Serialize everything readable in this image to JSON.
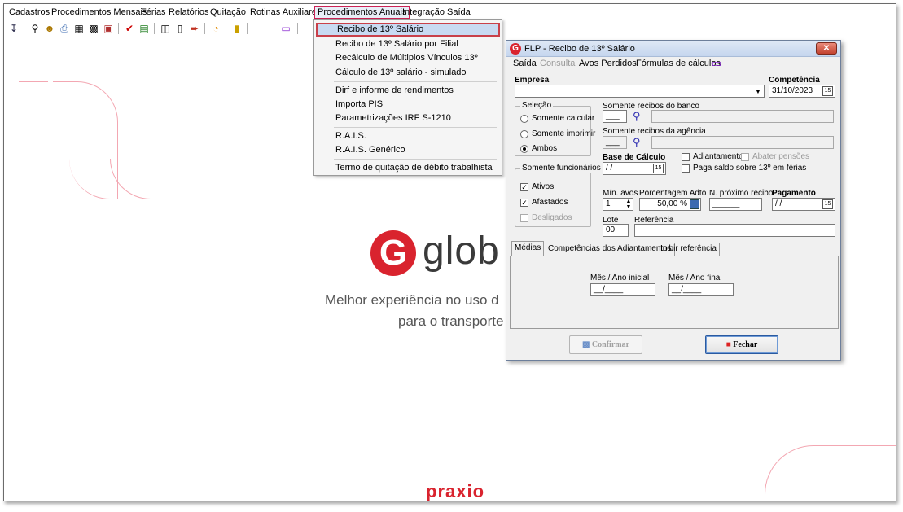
{
  "menubar": {
    "items": [
      "Cadastros",
      "Procedimentos Mensais",
      "Férias",
      "Relatórios",
      "Quitação",
      "Rotinas Auxiliares",
      "Procedimentos Anuais",
      "Integração",
      "Saída"
    ],
    "active": "Procedimentos Anuais"
  },
  "dropdown": {
    "items": [
      "Recibo de 13º Salário",
      "Recibo de 13º Salário por Filial",
      "Recálculo de Múltiplos Vínculos 13º",
      "Cálculo de 13º salário - simulado",
      "Dirf e informe de rendimentos",
      "Importa PIS",
      "Parametrizações IRF S-1210",
      "R.A.I.S.",
      "R.A.I.S. Genérico",
      "Termo de quitação de débito trabalhista"
    ],
    "selected": "Recibo de 13º Salário"
  },
  "background": {
    "logo_letter": "G",
    "logo_word": "glob",
    "tagline1": "Melhor experiência no uso d",
    "tagline2": "para o transporte",
    "brand": "praxio"
  },
  "dialog": {
    "title": "FLP - Recibo de 13º Salário",
    "menu": [
      "Saída",
      "Consulta",
      "Avos Perdidos",
      "Fórmulas de cálculos"
    ],
    "empresa_label": "Empresa",
    "empresa_value": "",
    "competencia_label": "Competência",
    "competencia_value": "31/10/2023",
    "selecao": {
      "title": "Seleção",
      "options": [
        "Somente calcular",
        "Somente imprimir",
        "Ambos"
      ],
      "selected": "Ambos"
    },
    "banco_label": "Somente recibos do banco",
    "agencia_label": "Somente recibos da agência",
    "base_calculo_label": "Base de Cálculo",
    "base_calculo_value": " / /",
    "adiantamento_label": "Adiantamento",
    "abater_pensoes_label": "Abater pensões",
    "paga_saldo_label": "Paga saldo sobre 13º em férias",
    "funcionarios": {
      "title": "Somente funcionários",
      "options": [
        {
          "label": "Ativos",
          "checked": true,
          "enabled": true
        },
        {
          "label": "Afastados",
          "checked": true,
          "enabled": true
        },
        {
          "label": "Desligados",
          "checked": false,
          "enabled": false
        }
      ]
    },
    "min_avos_label": "Mín. avos",
    "min_avos_value": "1",
    "porcentagem_label": "Porcentagem Adto",
    "porcentagem_value": "50,00 %",
    "proximo_recibo_label": "N. próximo recibo",
    "proximo_recibo_value": "______",
    "pagamento_label": "Pagamento",
    "pagamento_value": " / /",
    "lote_label": "Lote",
    "lote_value": "00",
    "referencia_label": "Referência",
    "referencia_value": "",
    "tabs": [
      "Médias",
      "Competências dos Adiantamentos",
      "Inibir referência"
    ],
    "active_tab": "Médias",
    "mes_ano_inicial_label": "Mês / Ano inicial",
    "mes_ano_inicial_value": "__/____",
    "mes_ano_final_label": "Mês / Ano final",
    "mes_ano_final_value": "__/____",
    "confirmar_label": "Confirmar",
    "fechar_label": "Fechar"
  },
  "colors": {
    "brand_red": "#d9232e",
    "selection_border": "#c9404a",
    "arrow": "#dd2222"
  }
}
